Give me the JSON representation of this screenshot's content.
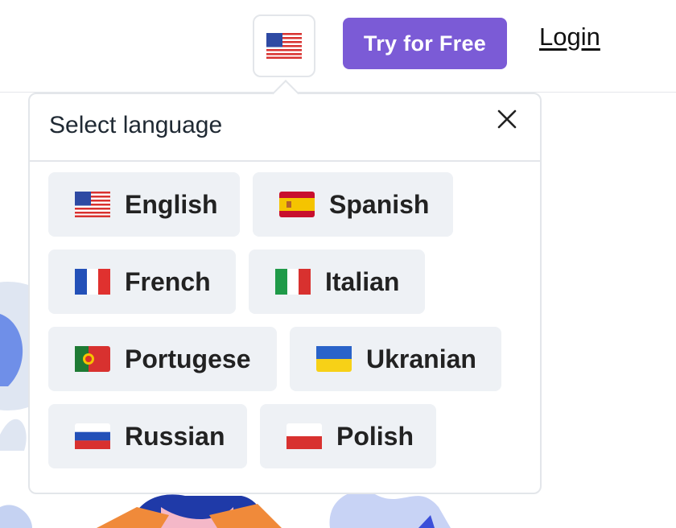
{
  "header": {
    "current_flag": "us-flag-icon",
    "try_label": "Try for Free",
    "login_label": "Login"
  },
  "colors": {
    "accent": "#7b5bd6",
    "chip_bg": "#eef1f5",
    "border": "#e3e6ea"
  },
  "popover": {
    "title": "Select language",
    "close_icon": "close-icon",
    "languages": [
      {
        "label": "English",
        "flag": "us-flag-icon"
      },
      {
        "label": "Spanish",
        "flag": "spain-flag-icon"
      },
      {
        "label": "French",
        "flag": "france-flag-icon"
      },
      {
        "label": "Italian",
        "flag": "italy-flag-icon"
      },
      {
        "label": "Portugese",
        "flag": "portugal-flag-icon"
      },
      {
        "label": "Ukranian",
        "flag": "ukraine-flag-icon"
      },
      {
        "label": "Russian",
        "flag": "russia-flag-icon"
      },
      {
        "label": "Polish",
        "flag": "poland-flag-icon"
      }
    ]
  }
}
